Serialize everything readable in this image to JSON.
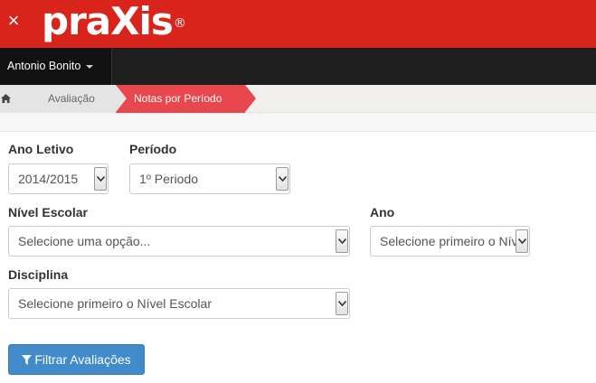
{
  "app": {
    "logo_text": "praXis",
    "logo_mark": "®",
    "close_symbol": "×"
  },
  "user": {
    "name": "Antonio Bonito"
  },
  "breadcrumb": {
    "items": [
      "Avaliação",
      "Notas por Período"
    ]
  },
  "form": {
    "ano_letivo": {
      "label": "Ano Letivo",
      "value": "2014/2015"
    },
    "periodo": {
      "label": "Período",
      "value": "1º Periodo"
    },
    "nivel_escolar": {
      "label": "Nível Escolar",
      "value": "Selecione uma opção..."
    },
    "ano": {
      "label": "Ano",
      "value": "Selecione primeiro o Nível Escolar"
    },
    "disciplina": {
      "label": "Disciplina",
      "value": "Selecione primeiro o Nível Escolar"
    }
  },
  "actions": {
    "filter_label": "Filtrar Avaliações"
  },
  "colors": {
    "brand_red": "#d9241b",
    "active_crumb": "#e8474e",
    "primary_button": "#428bca"
  },
  "icons": [
    "close-icon",
    "caret-down-icon",
    "home-icon",
    "select-arrow-icon",
    "filter-icon"
  ]
}
